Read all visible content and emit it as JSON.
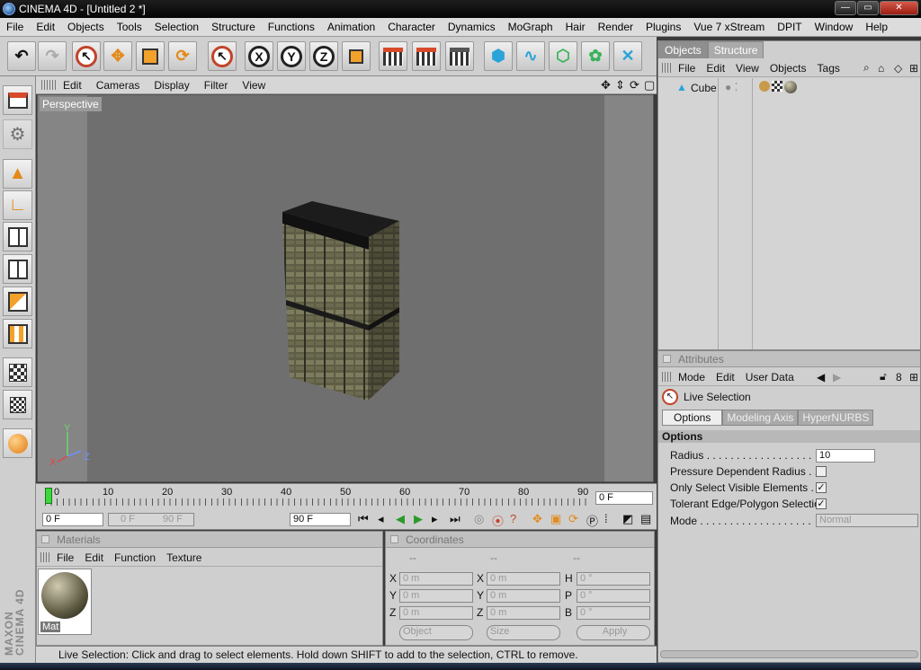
{
  "window": {
    "title": "CINEMA 4D - [Untitled 2 *]",
    "controls": [
      "—",
      "▭",
      "✕"
    ]
  },
  "menubar": [
    "File",
    "Edit",
    "Objects",
    "Tools",
    "Selection",
    "Structure",
    "Functions",
    "Animation",
    "Character",
    "Dynamics",
    "MoGraph",
    "Hair",
    "Render",
    "Plugins",
    "Vue 7 xStream",
    "DPIT",
    "Window",
    "Help"
  ],
  "toolbar": {
    "axis_x": "X",
    "axis_y": "Y",
    "axis_z": "Z"
  },
  "viewport": {
    "menu": [
      "Edit",
      "Cameras",
      "Display",
      "Filter",
      "View"
    ],
    "label": "Perspective",
    "axes": {
      "x": "X",
      "y": "Y",
      "z": "Z"
    }
  },
  "timeline": {
    "ticks": [
      "0",
      "10",
      "20",
      "30",
      "40",
      "50",
      "60",
      "70",
      "80",
      "90"
    ],
    "current_frame": "0 F"
  },
  "animation": {
    "start_frame": "0 F",
    "range_start": "0 F",
    "range_end": "90 F",
    "end_frame": "90 F"
  },
  "materials": {
    "title": "Materials",
    "menu": [
      "File",
      "Edit",
      "Function",
      "Texture"
    ],
    "items": [
      {
        "name": "Mat"
      }
    ]
  },
  "coordinates": {
    "title": "Coordinates",
    "col_headers": [
      "--",
      "--",
      "--"
    ],
    "rows": [
      {
        "l1": "X",
        "v1": "0 m",
        "l2": "X",
        "v2": "0 m",
        "l3": "H",
        "v3": "0 °"
      },
      {
        "l1": "Y",
        "v1": "0 m",
        "l2": "Y",
        "v2": "0 m",
        "l3": "P",
        "v3": "0 °"
      },
      {
        "l1": "Z",
        "v1": "0 m",
        "l2": "Z",
        "v2": "0 m",
        "l3": "B",
        "v3": "0 °"
      }
    ],
    "mode_select": "Object",
    "size_select": "Size",
    "apply": "Apply"
  },
  "brand": "MAXON CINEMA 4D",
  "status": "Live Selection: Click and drag to select elements. Hold down SHIFT to add to the selection, CTRL to remove.",
  "objects_panel": {
    "tabs": [
      "Objects",
      "Structure"
    ],
    "menu": [
      "File",
      "Edit",
      "View",
      "Objects",
      "Tags"
    ],
    "items": [
      {
        "name": "Cube"
      }
    ]
  },
  "attributes_panel": {
    "title": "Attributes",
    "menu": [
      "Mode",
      "Edit",
      "User Data"
    ],
    "tool_name": "Live Selection",
    "tabs": [
      "Options",
      "Modeling Axis",
      "HyperNURBS"
    ],
    "section": "Options",
    "fields": {
      "radius_label": "Radius . . . . . . . . . . . . . . . . . .",
      "radius_value": "10",
      "pressure_label": "Pressure Dependent Radius  . .",
      "visible_label": "Only Select Visible Elements  . . .",
      "tolerant_label": "Tolerant Edge/Polygon Selection",
      "mode_label": "Mode . . . . . . . . . . . . . . . . . . .",
      "mode_value": "Normal"
    },
    "check": "✓"
  }
}
